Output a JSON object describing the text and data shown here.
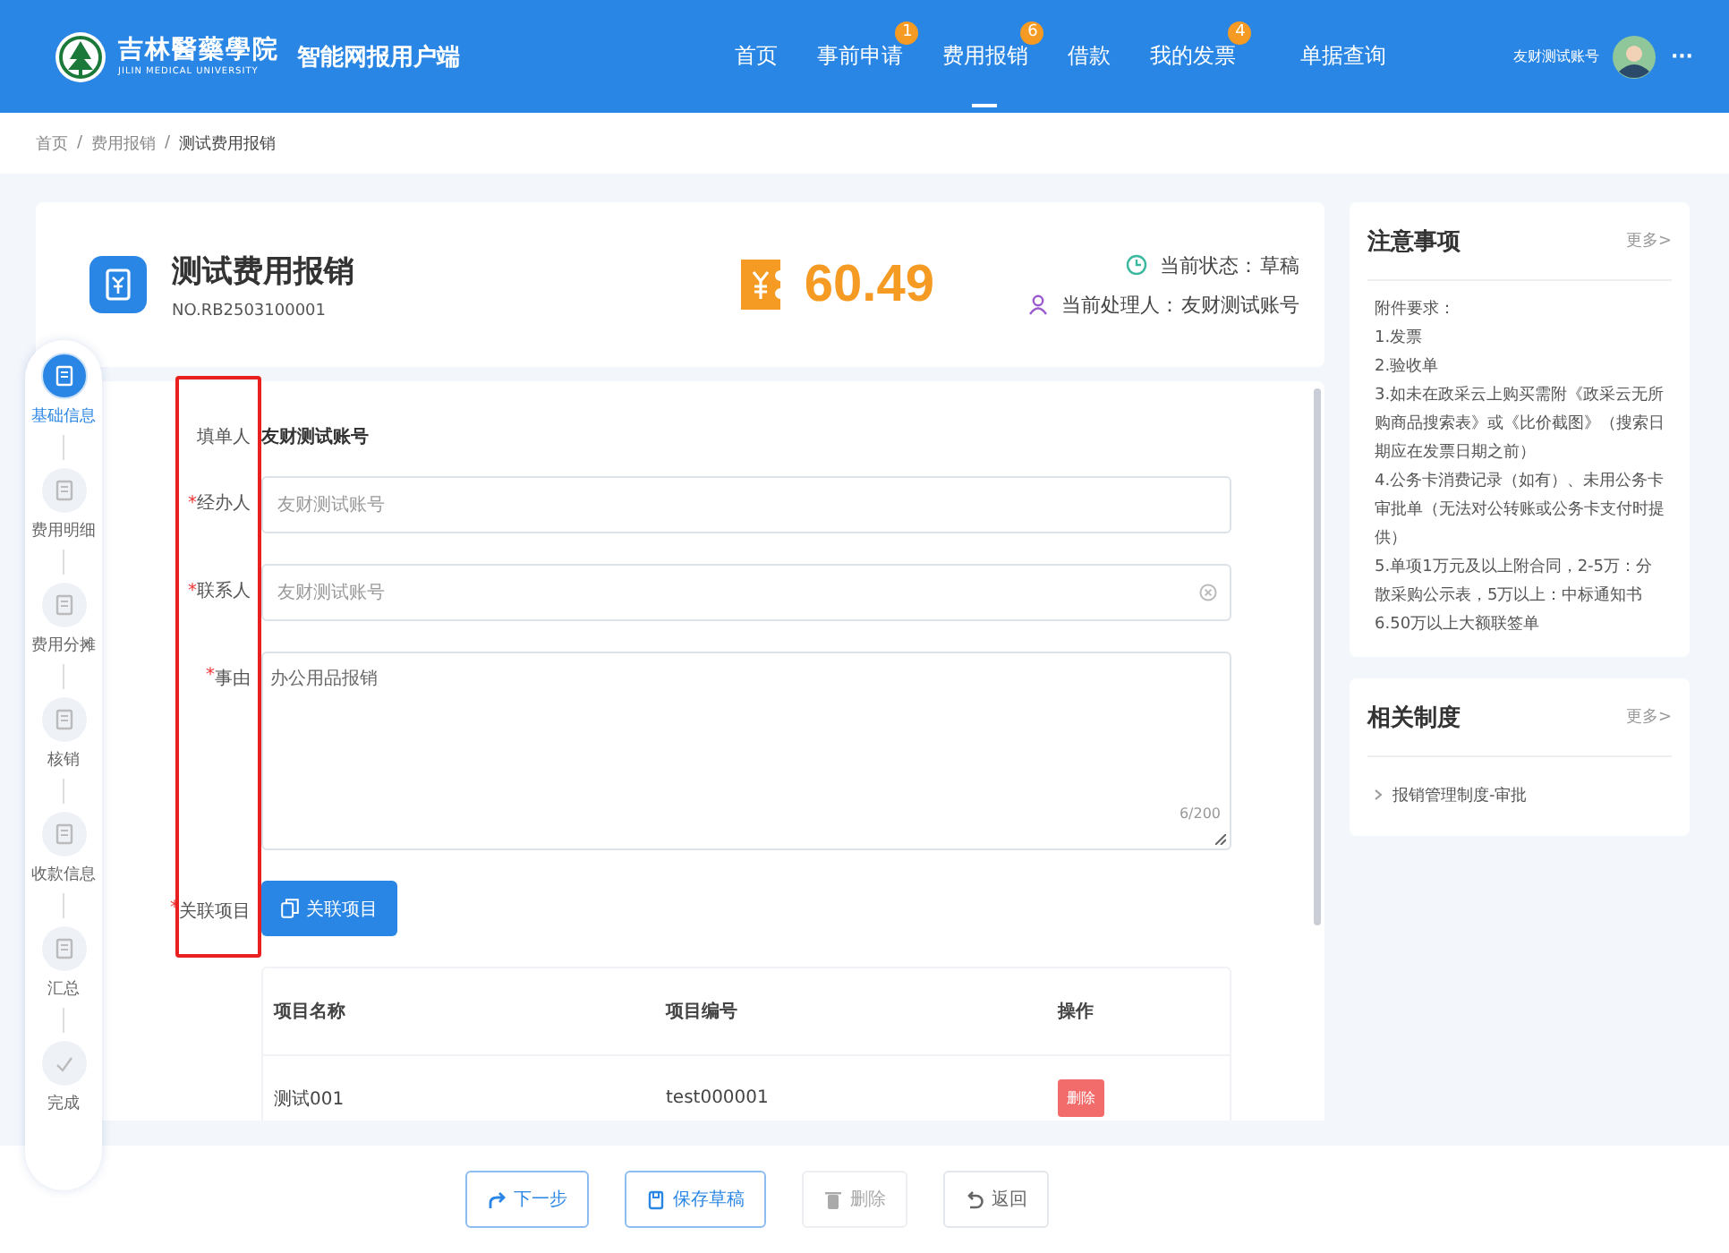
{
  "header": {
    "logo_text": "吉林醫藥學院",
    "logo_subtitle": "JILIN MEDICAL UNIVERSITY",
    "app_name": "智能网报用户端",
    "nav": [
      {
        "label": "首页",
        "selected": false
      },
      {
        "label": "事前申请",
        "badge": "1",
        "selected": false
      },
      {
        "label": "费用报销",
        "badge": "6",
        "selected": true
      },
      {
        "label": "借款",
        "selected": false
      },
      {
        "label": "我的发票",
        "badge": "4",
        "selected": false
      },
      {
        "label": "单据查询",
        "selected": false
      }
    ],
    "user_name": "友财测试账号",
    "more": "···"
  },
  "breadcrumb": {
    "separator": "/",
    "items": [
      "首页",
      "费用报销",
      "测试费用报销"
    ]
  },
  "summary": {
    "title": "测试费用报销",
    "number": "NO.RB2503100001",
    "amount": "60.49",
    "status_label": "当前状态：",
    "status": "草稿",
    "handler_label": "当前处理人：",
    "handler": "友财测试账号"
  },
  "steps": [
    {
      "label": "基础信息",
      "selected": true
    },
    {
      "label": "费用明细",
      "selected": false
    },
    {
      "label": "费用分摊",
      "selected": false
    },
    {
      "label": "核销",
      "selected": false
    },
    {
      "label": "收款信息",
      "selected": false
    },
    {
      "label": "汇总",
      "selected": false
    },
    {
      "label": "完成",
      "selected": false
    }
  ],
  "form": {
    "fields": [
      {
        "kind": "text",
        "label": "填单人",
        "value": "友财测试账号"
      },
      {
        "kind": "input",
        "mark": "*",
        "label": "经办人",
        "placeholder": "友财测试账号"
      },
      {
        "kind": "input",
        "mark": "*",
        "label": "联系人",
        "placeholder": "友财测试账号",
        "clearable": true
      },
      {
        "kind": "textarea",
        "mark": "*",
        "label": "事由",
        "value": "办公用品报销",
        "counter": "6/200"
      },
      {
        "kind": "button",
        "mark": "*",
        "label": "关联项目",
        "value": "关联项目"
      }
    ],
    "table": {
      "columns": [
        "项目名称",
        "项目编号",
        "操作"
      ],
      "rows": [
        {
          "cells": [
            "测试001",
            "test000001"
          ],
          "action": "删除"
        }
      ]
    }
  },
  "notes": {
    "title": "注意事项",
    "more": "更多>",
    "lines": [
      "附件要求：",
      "1.发票",
      "2.验收单",
      "3.如未在政采云上购买需附《政采云无所购商品搜索表》或《比价截图》（搜索日期应在发票日期之前）",
      "4.公务卡消费记录（如有）、未用公务卡审批单（无法对公转账或公务卡支付时提供）",
      "5.单项1万元及以上附合同，2-5万：分散采购公示表，5万以上：中标通知书",
      "6.50万以上大额联签单"
    ]
  },
  "related": {
    "title": "相关制度",
    "more": "更多>",
    "items": [
      "报销管理制度-审批"
    ]
  },
  "footer": [
    {
      "kind": "primary",
      "label": "下一步"
    },
    {
      "kind": "primary",
      "label": "保存草稿"
    },
    {
      "kind": "disabled",
      "label": "删除"
    },
    {
      "kind": "default",
      "label": "返回"
    }
  ]
}
